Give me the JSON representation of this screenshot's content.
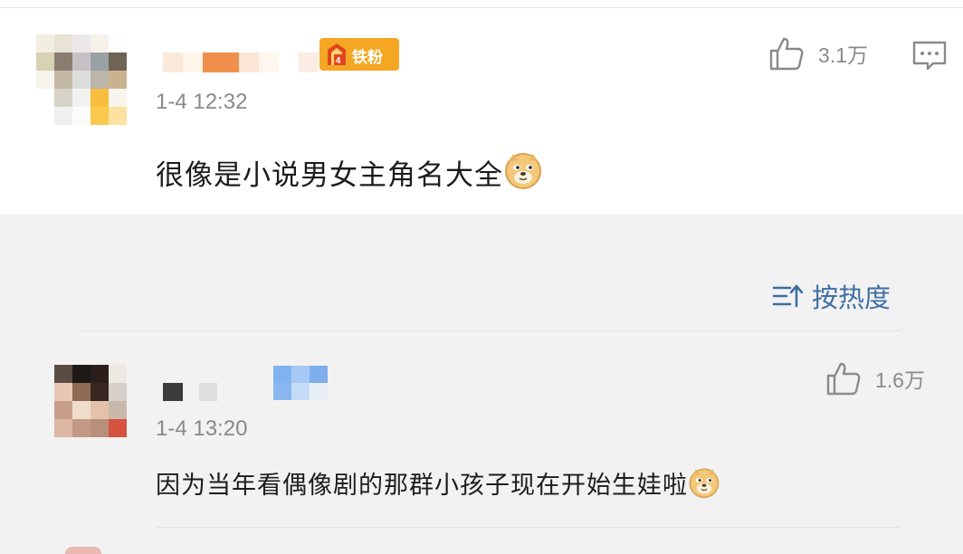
{
  "main_comment": {
    "badge_text": "铁粉",
    "badge_level": "4",
    "time": "1-4 12:32",
    "text": "很像是小说男女主角名大全",
    "emoji": "doge-emoji",
    "likes": "3.1万",
    "icons": {
      "like": "thumbs-up-icon",
      "comment": "comment-icon"
    }
  },
  "sort": {
    "label": "按热度",
    "icon": "sort-icon"
  },
  "reply": {
    "time": "1-4 13:20",
    "text": "因为当年看偶像剧的那群小孩子现在开始生娃啦",
    "emoji": "doge-emoji",
    "likes": "1.6万",
    "icons": {
      "like": "thumbs-up-icon"
    }
  },
  "colors": {
    "badge": "#f5a623",
    "link_blue": "#3f6fa3",
    "muted_text": "#8a8a8a",
    "background": "#f2f2f2"
  }
}
